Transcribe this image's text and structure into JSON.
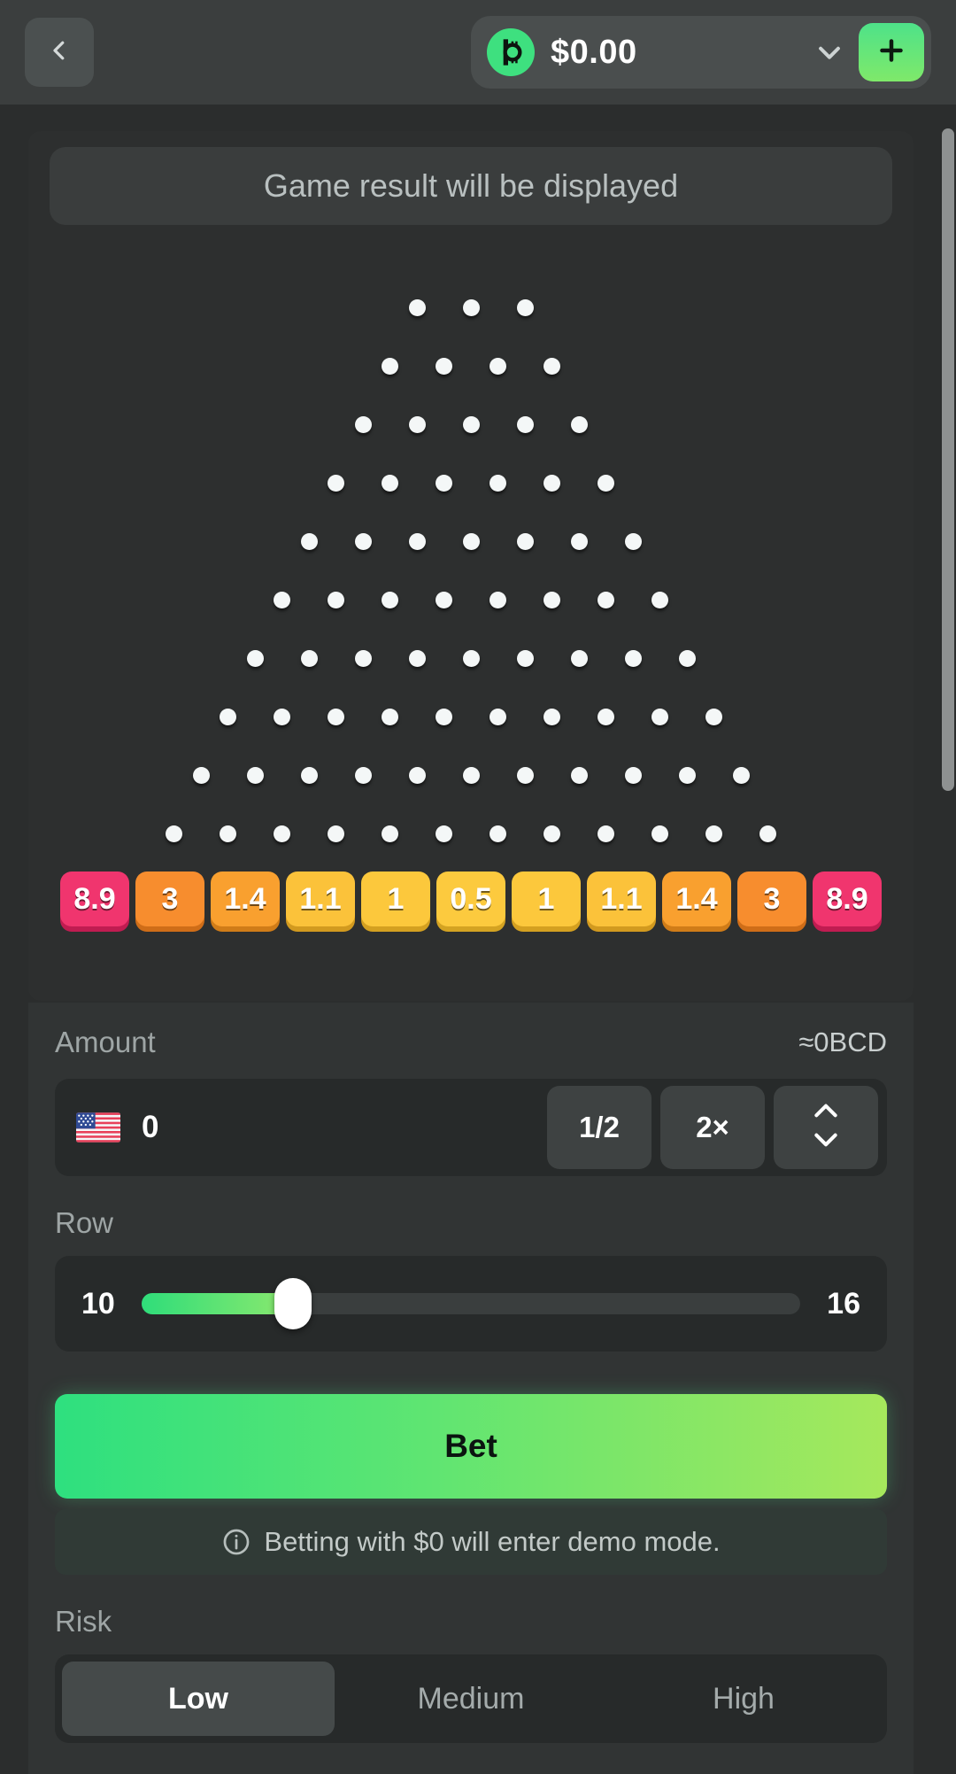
{
  "header": {
    "back_icon": "chevron-left-icon",
    "balance": {
      "coin_icon": "bitcoin-coin-icon",
      "amount": "$0.00",
      "dropdown_icon": "chevron-down-icon",
      "add_icon": "plus-icon"
    }
  },
  "board": {
    "result_text": "Game result will be displayed",
    "peg_rows": [
      3,
      4,
      5,
      6,
      7,
      8,
      9,
      10,
      11,
      12
    ],
    "multipliers": [
      {
        "label": "8.9",
        "color": "#f0356e",
        "shadow": "#c01c51"
      },
      {
        "label": "3",
        "color": "#f78d2e",
        "shadow": "#cf6d18"
      },
      {
        "label": "1.4",
        "color": "#f9a02f",
        "shadow": "#d07c18"
      },
      {
        "label": "1.1",
        "color": "#fbc23a",
        "shadow": "#d29a1f"
      },
      {
        "label": "1",
        "color": "#fcc83c",
        "shadow": "#d4a020"
      },
      {
        "label": "0.5",
        "color": "#fcca3e",
        "shadow": "#d4a322"
      },
      {
        "label": "1",
        "color": "#fcc83c",
        "shadow": "#d4a020"
      },
      {
        "label": "1.1",
        "color": "#fbc23a",
        "shadow": "#d29a1f"
      },
      {
        "label": "1.4",
        "color": "#f9a02f",
        "shadow": "#d07c18"
      },
      {
        "label": "3",
        "color": "#f78d2e",
        "shadow": "#cf6d18"
      },
      {
        "label": "8.9",
        "color": "#f0356e",
        "shadow": "#c01c51"
      }
    ]
  },
  "controls": {
    "amount": {
      "label": "Amount",
      "approx": "≈0BCD",
      "currency_icon": "us-flag-icon",
      "value": "0",
      "placeholder": "0",
      "half_label": "1/2",
      "double_label": "2×",
      "stepper_icon_up": "chevron-up-icon",
      "stepper_icon_down": "chevron-down-icon"
    },
    "row": {
      "label": "Row",
      "min": "10",
      "max": "16",
      "value": 10,
      "fill_percent": 23
    },
    "bet": {
      "label": "Bet"
    },
    "demo_note": {
      "icon": "info-icon",
      "text": "Betting with $0 will enter demo mode."
    },
    "risk": {
      "label": "Risk",
      "options": [
        "Low",
        "Medium",
        "High"
      ],
      "selected": "Low"
    }
  },
  "colors": {
    "page_bg": "#2b2d2d",
    "header_bg": "#3b3e3e",
    "panel_bg": "#2d2f2f",
    "controls_bg": "#313434",
    "card_bg": "#272a2a",
    "accent_green_start": "#2ee07f",
    "accent_green_end": "#a6e85c",
    "peg": "#f4f7f7",
    "scrollbar": "#8e9191"
  },
  "scrollbar": {
    "name": "vertical-scrollbar"
  }
}
